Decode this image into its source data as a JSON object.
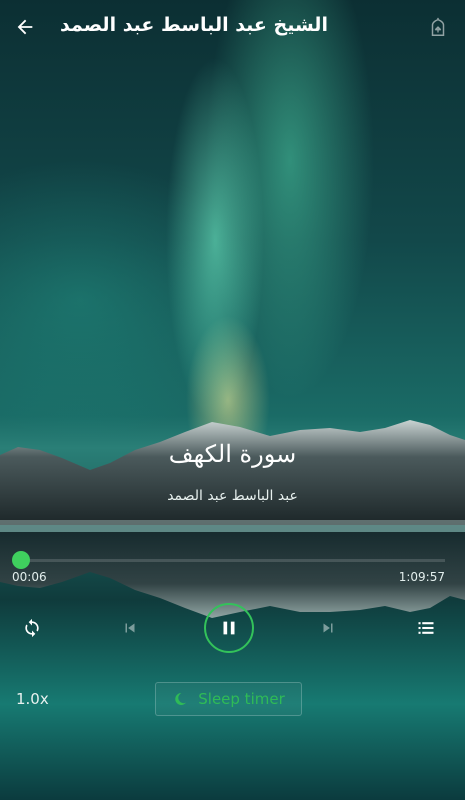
{
  "header": {
    "title": "الشيخ عبد الباسط عبد الصمد",
    "back_icon": "arrow-left-icon",
    "home_icon": "home-mosque-icon"
  },
  "track": {
    "surah": "سورة الكهف",
    "reciter": "عبد الباسط عبد الصمد"
  },
  "player": {
    "elapsed": "00:06",
    "total": "1:09:57",
    "progress_fraction": 0.001,
    "accent_color": "#33c25a",
    "speed_label": "1.0x",
    "sleep_timer_label": "Sleep timer",
    "icons": {
      "repeat": "repeat-icon",
      "previous": "skip-previous-icon",
      "play_pause": "pause-icon",
      "next": "skip-next-icon",
      "playlist": "playlist-icon",
      "sleep": "moon-icon"
    }
  }
}
